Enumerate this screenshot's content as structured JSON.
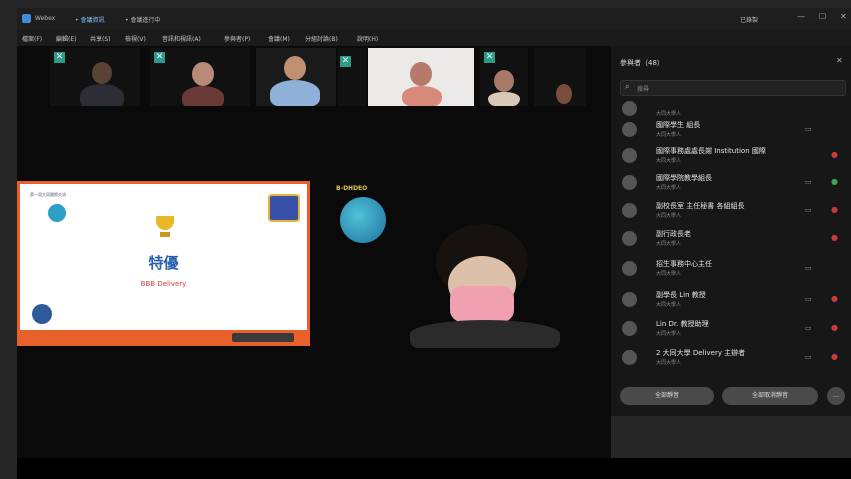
{
  "titlebar": {
    "app_name": "Webex",
    "tab1": "• 會議資訊",
    "tab2": "• 會議進行中",
    "right_text": "已錄製",
    "min": "—",
    "max": "☐",
    "close": "✕"
  },
  "menu": [
    "檔案(F)",
    "編輯(E)",
    "共享(S)",
    "檢視(V)",
    "音訊和視訊(A)",
    "參與者(P)",
    "會議(M)",
    "分組討論(B)",
    "說明(H)"
  ],
  "participants_panel": {
    "title": "參與者（48）",
    "search_placeholder": "搜尋",
    "rows": [
      {
        "name": "",
        "sub": "大同大學人"
      },
      {
        "name": "國際學生  組長",
        "sub": "大同大學人"
      },
      {
        "name": "國際事務處處長謝  Institution 國際",
        "sub": "大同大學人"
      },
      {
        "name": "國際學院教學組長",
        "sub": "大同大學人"
      },
      {
        "name": "副校長室 主任秘書 各組組長",
        "sub": "大同大學人"
      },
      {
        "name": "副行政長老",
        "sub": "大同大學人"
      },
      {
        "name": "招生事務中心主任",
        "sub": "大同大學人"
      },
      {
        "name": "副學長 Lin 教授",
        "sub": "大同大學人"
      },
      {
        "name": "Lin Dr. 教授助理",
        "sub": "大同大學人"
      },
      {
        "name": "2  大同大學 Delivery 主辦者",
        "sub": "大同大學人"
      }
    ],
    "btn_mute_all": "全部靜音",
    "btn_unmute_all": "全部取消靜音",
    "btn_more": "…"
  },
  "slide": {
    "title": "特優",
    "subtitle": "BBB Delivery",
    "corner_text": "第一屆大同國際交流"
  },
  "video_label": "B-DHDEO",
  "colors": {
    "accent": "#2f9a8a",
    "slide_border": "#e8612a",
    "status_green": "#3aa55a",
    "status_red": "#c83a3a"
  }
}
